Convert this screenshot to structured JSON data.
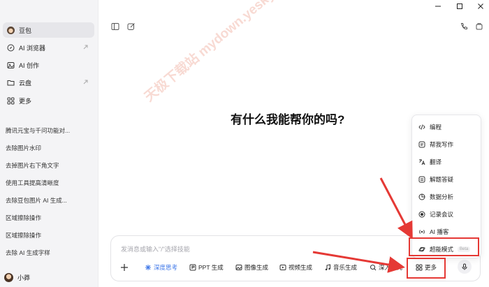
{
  "window": {
    "minimize": "—",
    "maximize": "☐",
    "close": "✕"
  },
  "sidebar": {
    "nav": [
      {
        "label": "豆包",
        "icon": "doubao-avatar-icon"
      },
      {
        "label": "AI 浏览器",
        "icon": "compass-icon"
      },
      {
        "label": "AI 创作",
        "icon": "image-icon"
      },
      {
        "label": "云盘",
        "icon": "folder-icon"
      },
      {
        "label": "更多",
        "icon": "grid-icon"
      }
    ],
    "history": [
      "腾讯元宝与千问功能对...",
      "去除图片水印",
      "去掉图片右下角文字",
      "使用工具提高清晰度",
      "去除豆包图片 AI 生成...",
      "区域擦除操作",
      "区域擦除操作",
      "去除 AI 生成字样"
    ],
    "user": "小莽"
  },
  "main": {
    "headline": "有什么我能帮你的吗?",
    "watermark": "天极下载站 mydown.yesky.com"
  },
  "input": {
    "placeholder": "发消息或输入\"/\"选择技能",
    "chips": [
      {
        "label": "深度思考",
        "icon": "deep-think-icon",
        "active": true
      },
      {
        "label": "PPT 生成",
        "icon": "ppt-icon"
      },
      {
        "label": "图像生成",
        "icon": "image-gen-icon"
      },
      {
        "label": "视频生成",
        "icon": "video-icon"
      },
      {
        "label": "音乐生成",
        "icon": "music-icon"
      },
      {
        "label": "深入研究",
        "icon": "research-icon"
      },
      {
        "label": "更多",
        "icon": "grid-icon"
      }
    ]
  },
  "menu": {
    "items": [
      {
        "label": "编程",
        "icon": "code-icon"
      },
      {
        "label": "帮我写作",
        "icon": "write-icon"
      },
      {
        "label": "翻译",
        "icon": "translate-icon"
      },
      {
        "label": "解题答疑",
        "icon": "solve-icon"
      },
      {
        "label": "数据分析",
        "icon": "chart-icon"
      },
      {
        "label": "记录会议",
        "icon": "record-icon"
      },
      {
        "label": "AI 播客",
        "icon": "podcast-icon"
      },
      {
        "label": "超能模式",
        "icon": "planet-icon",
        "badge": "Beta"
      }
    ]
  },
  "colors": {
    "accent": "#3a74e8",
    "highlight": "#e53935"
  }
}
